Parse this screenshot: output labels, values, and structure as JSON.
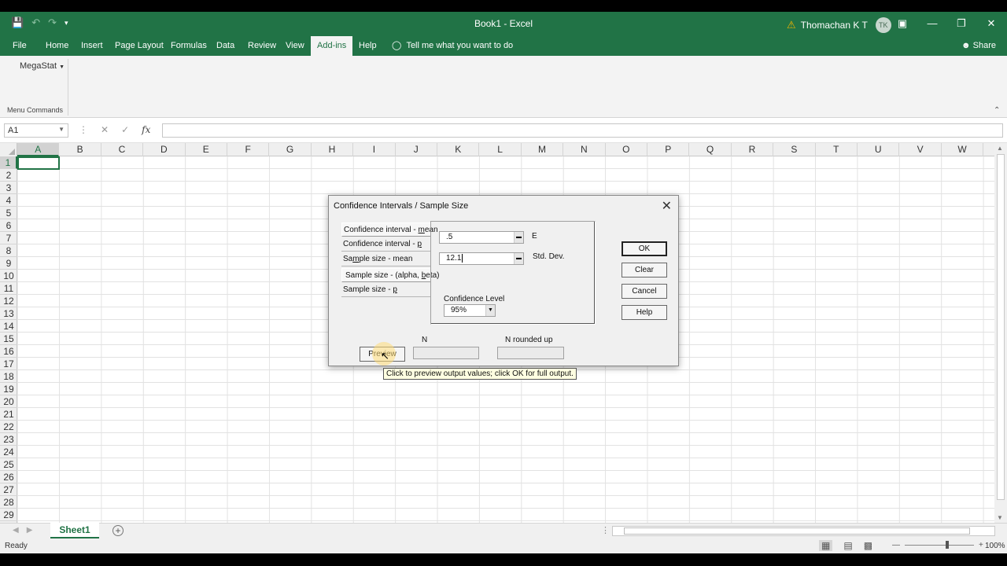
{
  "window": {
    "title": "Book1  -  Excel",
    "user_name": "Thomachan K T",
    "user_initials": "TK"
  },
  "ribbon": {
    "tabs": [
      {
        "label": "File"
      },
      {
        "label": "Home"
      },
      {
        "label": "Insert"
      },
      {
        "label": "Page Layout"
      },
      {
        "label": "Formulas"
      },
      {
        "label": "Data"
      },
      {
        "label": "Review"
      },
      {
        "label": "View"
      },
      {
        "label": "Add-ins",
        "active": true
      },
      {
        "label": "Help"
      }
    ],
    "tell_me": "Tell me what you want to do",
    "share": "Share",
    "megastat_label": "MegaStat",
    "group_label": "Menu Commands"
  },
  "formula_bar": {
    "name_box": "A1",
    "formula": ""
  },
  "grid": {
    "columns": [
      "A",
      "B",
      "C",
      "D",
      "E",
      "F",
      "G",
      "H",
      "I",
      "J",
      "K",
      "L",
      "M",
      "N",
      "O",
      "P",
      "Q",
      "R",
      "S",
      "T",
      "U",
      "V",
      "W"
    ],
    "rows": [
      "1",
      "2",
      "3",
      "4",
      "5",
      "6",
      "7",
      "8",
      "9",
      "10",
      "11",
      "12",
      "13",
      "14",
      "15",
      "16",
      "17",
      "18",
      "19",
      "20",
      "21",
      "22",
      "23",
      "24",
      "25",
      "26",
      "27",
      "28",
      "29"
    ],
    "active_cell": "A1"
  },
  "sheets": {
    "active": "Sheet1"
  },
  "status": {
    "ready": "Ready",
    "zoom": "100%"
  },
  "dialog": {
    "title": "Confidence Intervals / Sample Size",
    "options": [
      {
        "pre": "Confidence interval - ",
        "u": "m",
        "post": "ean"
      },
      {
        "pre": "Confidence interval - ",
        "u": "p",
        "post": ""
      },
      {
        "pre": "Sa",
        "u": "m",
        "post": "ple size - mean"
      },
      {
        "pre": "Sample size - (alpha, ",
        "u": "b",
        "post": "eta)"
      },
      {
        "pre": "Sample size - ",
        "u": "p",
        "post": ""
      }
    ],
    "e_value": ".5",
    "e_label": "E",
    "stddev_value": "12.1",
    "stddev_label": "Std. Dev.",
    "confidence_label": "Confidence Level",
    "confidence_value": "95%",
    "ok": "OK",
    "clear": "Clear",
    "cancel": "Cancel",
    "help": "Help",
    "preview": "Preview",
    "n_label": "N",
    "n_rounded_label": "N rounded up",
    "tooltip": "Click to preview output values; click OK for full output."
  }
}
